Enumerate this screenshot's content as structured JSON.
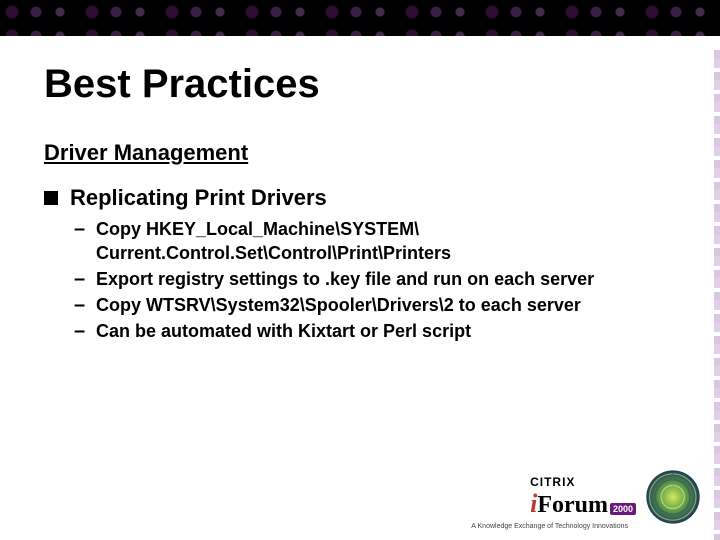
{
  "title": "Best Practices",
  "subtitle": "Driver Management",
  "section_heading": "Replicating Print Drivers",
  "bullets": [
    "Copy HKEY_Local_Machine\\SYSTEM\\ Current.Control.Set\\Control\\Print\\Printers",
    "Export registry settings to .key file and run on each server",
    "Copy WTSRV\\System32\\Spooler\\Drivers\\2 to each server",
    "Can be automated with Kixtart or Perl script"
  ],
  "logo": {
    "brand_small": "CITRIX",
    "i": "i",
    "forum": "Forum",
    "year": "2000",
    "tagline": "A Knowledge Exchange of Technology Innovations"
  }
}
